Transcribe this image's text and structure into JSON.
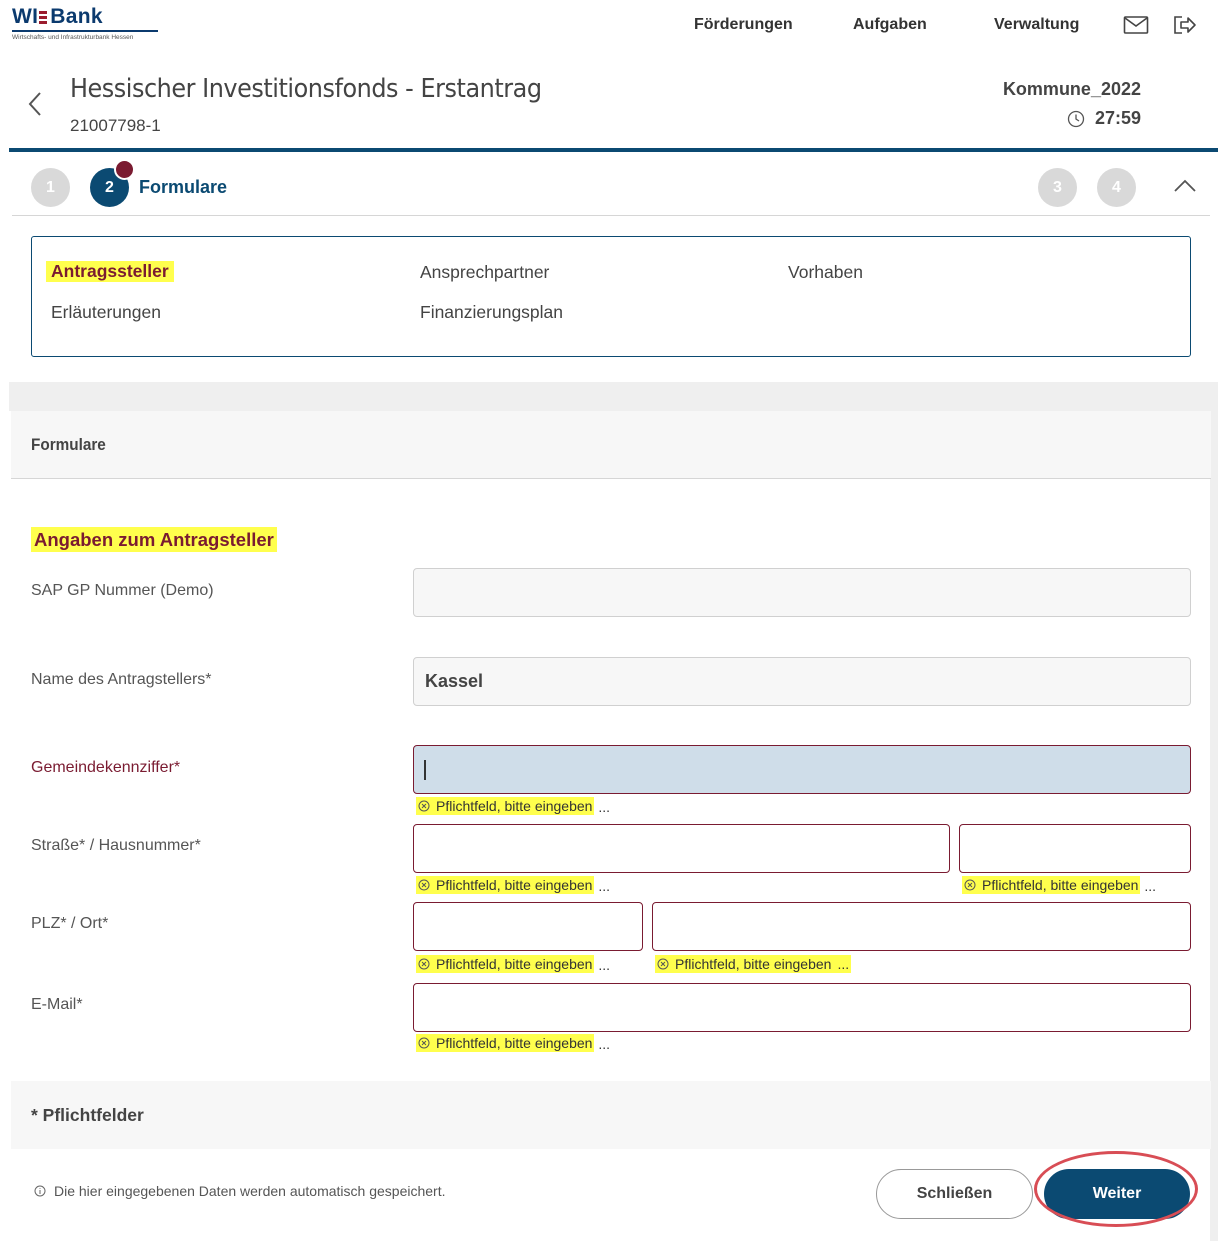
{
  "brand": {
    "logo_name": "WIBank",
    "logo_left": "WI",
    "logo_right": "Bank",
    "logo_subtitle": "Wirtschafts- und Infrastrukturbank Hessen"
  },
  "nav": {
    "items": [
      {
        "label": "Förderungen"
      },
      {
        "label": "Aufgaben"
      },
      {
        "label": "Verwaltung"
      }
    ],
    "icons": [
      "mail-icon",
      "logout-icon"
    ]
  },
  "header": {
    "title": "Hessischer Investitionsfonds - Erstantrag",
    "id": "21007798-1",
    "user": "Kommune_2022",
    "timer": "27:59"
  },
  "stepper": {
    "steps": [
      {
        "number": "1",
        "state": "inactive"
      },
      {
        "number": "2",
        "state": "active",
        "label": "Formulare"
      },
      {
        "number": "3",
        "state": "inactive"
      },
      {
        "number": "4",
        "state": "inactive"
      }
    ]
  },
  "sections": [
    {
      "label": "Antragssteller",
      "current": true
    },
    {
      "label": "Ansprechpartner",
      "current": false
    },
    {
      "label": "Vorhaben",
      "current": false
    },
    {
      "label": "Erläuterungen",
      "current": false
    },
    {
      "label": "Finanzierungsplan",
      "current": false
    }
  ],
  "form": {
    "panel_title": "Formulare",
    "heading": "Angaben zum Antragsteller",
    "fields": {
      "sap": {
        "label": "SAP GP Nummer (Demo)",
        "value": ""
      },
      "name": {
        "label": "Name des Antragstellers*",
        "value": "Kassel"
      },
      "gkz": {
        "label": "Gemeindekennziffer*",
        "value": ""
      },
      "strasse": {
        "label": "Straße* / Hausnummer*",
        "value": ""
      },
      "hausnummer": {
        "value": ""
      },
      "plz": {
        "label": "PLZ* / Ort*",
        "value": ""
      },
      "ort": {
        "value": ""
      },
      "email": {
        "label": "E-Mail*",
        "value": ""
      }
    },
    "error_message": "Pflichtfeld, bitte eingeben",
    "error_ellipsis": "...",
    "required_note": "* Pflichtfelder"
  },
  "footer": {
    "autosave_note": "Die hier eingegebenen Daten werden automatisch gespeichert.",
    "close_label": "Schließen",
    "next_label": "Weiter"
  },
  "colors": {
    "primary": "#0b4a72",
    "error": "#7a1b31",
    "highlight": "#ffff4d",
    "annotation_ring": "#d84d55"
  }
}
